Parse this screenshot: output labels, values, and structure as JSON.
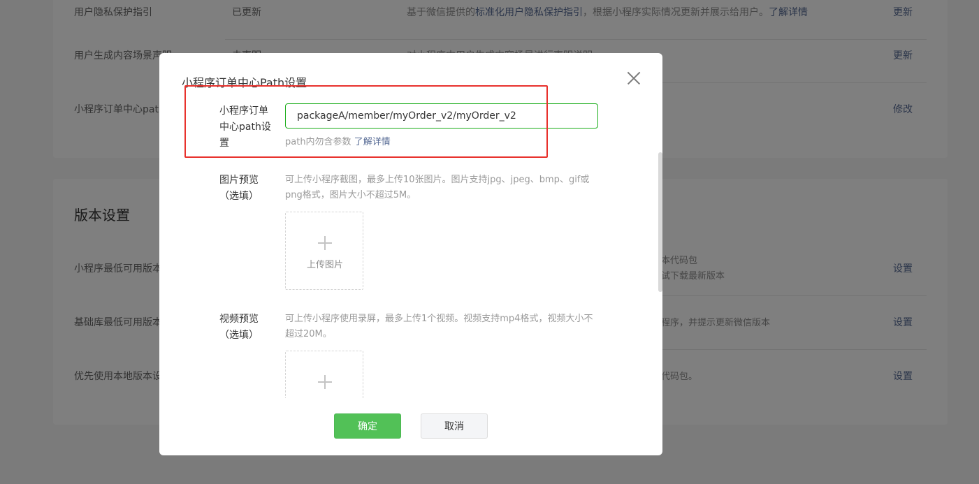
{
  "background": {
    "card1_rows": [
      {
        "label": "用户隐私保护指引",
        "status": "已更新",
        "desc_prefix": "基于微信提供的",
        "desc_link1": "标准化用户隐私保护指引",
        "desc_suffix": "，根据小程序实际情况更新并展示给用户。",
        "desc_link2": "了解详情",
        "action": "更新"
      },
      {
        "label": "用户生成内容场景声明",
        "status": "未声明",
        "desc": "对小程序中用户生成内容场景进行声明说明",
        "action": "更新"
      },
      {
        "label": "小程序订单中心path",
        "status": "",
        "desc": "",
        "action": "修改"
      }
    ],
    "section_title": "版本设置",
    "card2_rows": [
      {
        "label": "小程序最低可用版本",
        "desc_line1": "本代码包",
        "desc_line2": "试下载最新版本",
        "action": "设置"
      },
      {
        "label": "基础库最低可用版本",
        "desc_line1": "程序，并提示更新微信版本",
        "desc_line2": "",
        "action": "设置"
      },
      {
        "label": "优先使用本地版本设置",
        "desc_line1": "代码包。",
        "desc_line2": "",
        "action": "设置"
      }
    ]
  },
  "dialog": {
    "title": "小程序订单中心Path设置",
    "path_field": {
      "label": "小程序订单中心path设置",
      "value": "packageA/member/myOrder_v2/myOrder_v2",
      "hint": "path内勿含参数",
      "hint_link": "了解详情"
    },
    "image_preview": {
      "label": "图片预览（选填）",
      "tip": "可上传小程序截图，最多上传10张图片。图片支持jpg、jpeg、bmp、gif或png格式，图片大小不超过5M。",
      "upload_label": "上传图片"
    },
    "video_preview": {
      "label": "视频预览（选填）",
      "tip": "可上传小程序使用录屏，最多上传1个视频。视频支持mp4格式，视频大小不超过20M。"
    },
    "confirm_label": "确定",
    "cancel_label": "取消"
  },
  "colors": {
    "primary": "#52c157",
    "link": "#576b95",
    "highlight": "#e8322d"
  }
}
